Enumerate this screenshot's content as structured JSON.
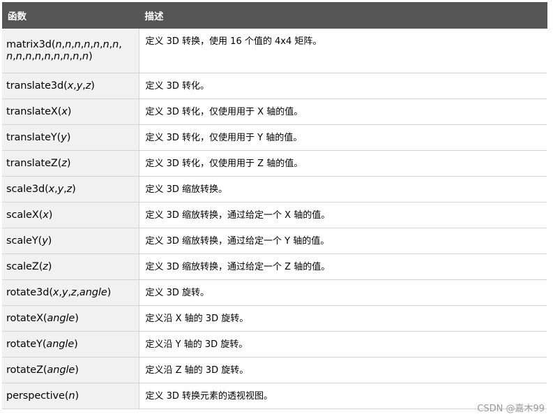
{
  "table": {
    "headers": [
      "函数",
      "描述"
    ],
    "rows": [
      {
        "fn": [
          [
            "matrix3d(",
            false
          ],
          [
            "n",
            true
          ],
          [
            ",",
            false
          ],
          [
            "n",
            true
          ],
          [
            ",",
            false
          ],
          [
            "n",
            true
          ],
          [
            ",",
            false
          ],
          [
            "n",
            true
          ],
          [
            ",",
            false
          ],
          [
            "n",
            true
          ],
          [
            ",",
            false
          ],
          [
            "n",
            true
          ],
          [
            ",",
            false
          ],
          [
            "n",
            true
          ],
          [
            ", ",
            false
          ],
          [
            "n",
            true
          ],
          [
            ",",
            false
          ],
          [
            "n",
            true
          ],
          [
            ",",
            false
          ],
          [
            "n",
            true
          ],
          [
            ",",
            false
          ],
          [
            "n",
            true
          ],
          [
            ",",
            false
          ],
          [
            "n",
            true
          ],
          [
            ",",
            false
          ],
          [
            "n",
            true
          ],
          [
            ",",
            false
          ],
          [
            "n",
            true
          ],
          [
            ",",
            false
          ],
          [
            "n",
            true
          ],
          [
            ",",
            false
          ],
          [
            "n",
            true
          ],
          [
            ")",
            false
          ]
        ],
        "desc": "定义 3D 转换，使用 16 个值的 4x4 矩阵。"
      },
      {
        "fn": [
          [
            "translate3d(",
            false
          ],
          [
            "x",
            true
          ],
          [
            ",",
            false
          ],
          [
            "y",
            true
          ],
          [
            ",",
            false
          ],
          [
            "z",
            true
          ],
          [
            ")",
            false
          ]
        ],
        "desc": "定义 3D 转化。"
      },
      {
        "fn": [
          [
            "translateX(",
            false
          ],
          [
            "x",
            true
          ],
          [
            ")",
            false
          ]
        ],
        "desc": "定义 3D 转化，仅使用用于 X 轴的值。"
      },
      {
        "fn": [
          [
            "translateY(",
            false
          ],
          [
            "y",
            true
          ],
          [
            ")",
            false
          ]
        ],
        "desc": "定义 3D 转化，仅使用用于 Y 轴的值。"
      },
      {
        "fn": [
          [
            "translateZ(",
            false
          ],
          [
            "z",
            true
          ],
          [
            ")",
            false
          ]
        ],
        "desc": "定义 3D 转化，仅使用用于 Z 轴的值。"
      },
      {
        "fn": [
          [
            "scale3d(",
            false
          ],
          [
            "x",
            true
          ],
          [
            ",",
            false
          ],
          [
            "y",
            true
          ],
          [
            ",",
            false
          ],
          [
            "z",
            true
          ],
          [
            ")",
            false
          ]
        ],
        "desc": "定义 3D 缩放转换。"
      },
      {
        "fn": [
          [
            "scaleX(",
            false
          ],
          [
            "x",
            true
          ],
          [
            ")",
            false
          ]
        ],
        "desc": "定义 3D 缩放转换，通过给定一个 X 轴的值。"
      },
      {
        "fn": [
          [
            "scaleY(",
            false
          ],
          [
            "y",
            true
          ],
          [
            ")",
            false
          ]
        ],
        "desc": "定义 3D 缩放转换，通过给定一个 Y 轴的值。"
      },
      {
        "fn": [
          [
            "scaleZ(",
            false
          ],
          [
            "z",
            true
          ],
          [
            ")",
            false
          ]
        ],
        "desc": "定义 3D 缩放转换，通过给定一个 Z 轴的值。"
      },
      {
        "fn": [
          [
            "rotate3d(",
            false
          ],
          [
            "x",
            true
          ],
          [
            ",",
            false
          ],
          [
            "y",
            true
          ],
          [
            ",",
            false
          ],
          [
            "z",
            true
          ],
          [
            ",",
            false
          ],
          [
            "angle",
            true
          ],
          [
            ")",
            false
          ]
        ],
        "desc": "定义 3D 旋转。"
      },
      {
        "fn": [
          [
            "rotateX(",
            false
          ],
          [
            "angle",
            true
          ],
          [
            ")",
            false
          ]
        ],
        "desc": "定义沿 X 轴的 3D 旋转。"
      },
      {
        "fn": [
          [
            "rotateY(",
            false
          ],
          [
            "angle",
            true
          ],
          [
            ")",
            false
          ]
        ],
        "desc": "定义沿 Y 轴的 3D 旋转。"
      },
      {
        "fn": [
          [
            "rotateZ(",
            false
          ],
          [
            "angle",
            true
          ],
          [
            ")",
            false
          ]
        ],
        "desc": "定义沿 Z 轴的 3D 旋转。"
      },
      {
        "fn": [
          [
            "perspective(",
            false
          ],
          [
            "n",
            true
          ],
          [
            ")",
            false
          ]
        ],
        "desc": "定义 3D 转换元素的透视视图。"
      }
    ]
  },
  "watermark": "CSDN @嘉木99",
  "colors": {
    "header_bg": "#555555",
    "header_text": "#ffffff",
    "fn_cell_bg": "#f1f1f1",
    "border": "#d4d4d4",
    "watermark": "#9a9a9a"
  }
}
